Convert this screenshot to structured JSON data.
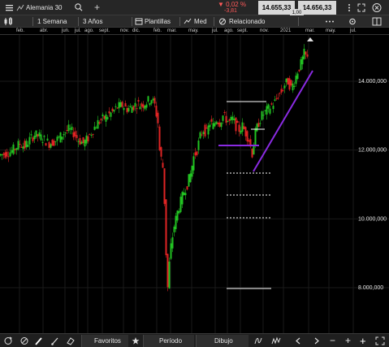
{
  "header": {
    "instrument": "Alemania 30",
    "change_pct": "▼ 0,02 %",
    "change_abs": "-3,81",
    "bid": "14.655,33",
    "ask": "14.656,33",
    "spread": "1,00"
  },
  "toolbar": {
    "period": "1 Semana",
    "range": "3 Años",
    "templates": "Plantillas",
    "indicator": "Med",
    "related": "Relacionado"
  },
  "x_axis": {
    "months": [
      "feb.",
      "abr.",
      "jun.",
      "jul.",
      "ago.",
      "sept.",
      "nov.",
      "dic.",
      "feb.",
      "mar.",
      "may.",
      "jul.",
      "ago.",
      "sept.",
      "nov.",
      "2021",
      "mar.",
      "may.",
      "jul."
    ]
  },
  "y_axis": {
    "ticks": [
      "14.000,000",
      "12.000,000",
      "10.000,000",
      "8.000,000"
    ]
  },
  "bottom": {
    "favorites": "Favoritos",
    "period": "Período",
    "drawing": "Dibujo"
  },
  "colors": {
    "up": "#22c322",
    "down": "#e02424",
    "trendline": "#8a2be2",
    "background": "#000000"
  },
  "chart_data": {
    "type": "candlestick",
    "y_ticks": [
      14000,
      12000,
      10000,
      8000
    ],
    "current_price": 14655
  }
}
